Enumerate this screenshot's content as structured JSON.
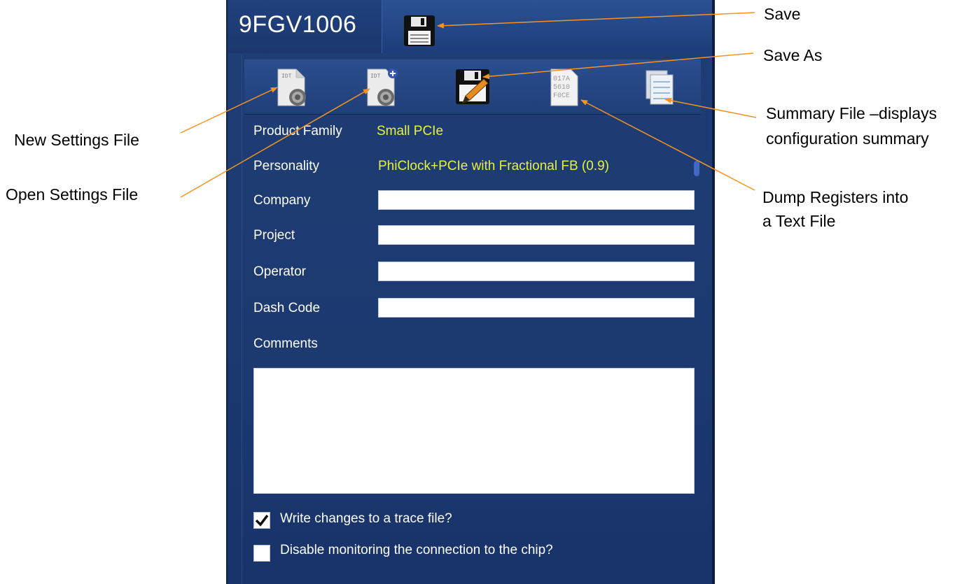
{
  "app": {
    "title": "9FGV1006"
  },
  "toolbar": {
    "buttons": [
      {
        "label": "New Settings File",
        "icon": "new-settings-file-icon"
      },
      {
        "label": "Open Settings File",
        "icon": "open-settings-file-icon"
      },
      {
        "label": "Save As",
        "icon": "save-as-icon"
      },
      {
        "label": "Dump Registers into a Text File",
        "icon": "dump-registers-icon"
      },
      {
        "label": "Summary File",
        "icon": "summary-file-icon"
      }
    ]
  },
  "form": {
    "product_family_label": "Product Family",
    "product_family_value": "Small PCIe",
    "personality_label": "Personality",
    "personality_value": "PhiClock+PCIe with Fractional FB (0.9)",
    "company_label": "Company",
    "company_value": "",
    "project_label": "Project",
    "project_value": "",
    "operator_label": "Operator",
    "operator_value": "",
    "dash_code_label": "Dash Code",
    "dash_code_value": "",
    "comments_label": "Comments",
    "comments_value": "",
    "trace_checkbox_label": "Write changes to a trace file?",
    "trace_checked": true,
    "monitor_checkbox_label": "Disable monitoring the connection to the chip?",
    "monitor_checked": false
  },
  "callouts": {
    "save": "Save",
    "save_as": "Save As",
    "new_settings": "New Settings File",
    "open_settings": "Open Settings File",
    "summary_line1": "Summary File –displays",
    "summary_line2": "configuration summary",
    "dump_line1": "Dump Registers into",
    "dump_line2": "a Text File"
  },
  "colors": {
    "panel_bg": "#1d3b72",
    "value_text": "#e6f23a",
    "arrow": "#f7941d"
  }
}
